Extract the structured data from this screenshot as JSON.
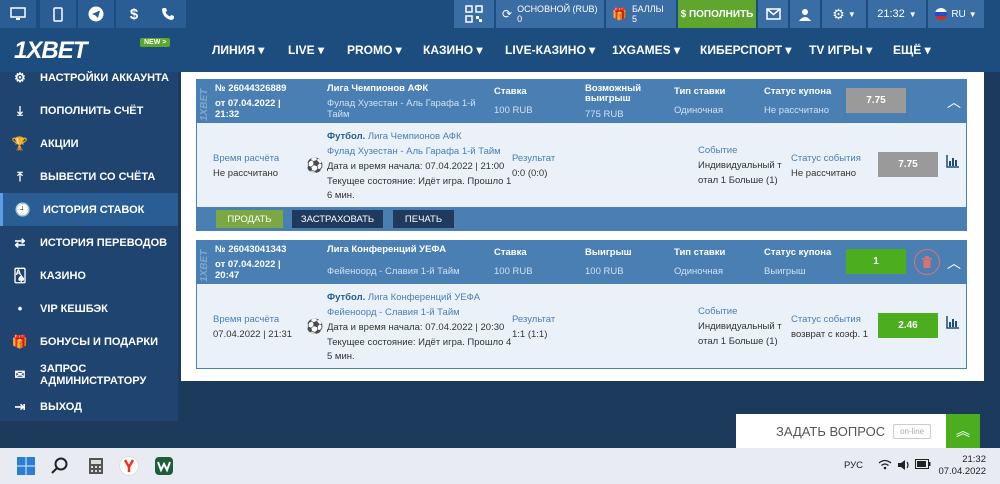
{
  "topbar": {
    "balance_label": "ОСНОВНОЙ (RUB)",
    "balance_value": "0",
    "bonus_label": "БАЛЛЫ",
    "bonus_value": "5",
    "deposit_label": "$ ПОПОЛНИТЬ",
    "time": "21:32",
    "lang": "RU"
  },
  "nav": {
    "logo": "1XBET",
    "new_badge": "NEW >",
    "items": [
      "ЛИНИЯ",
      "LIVE",
      "PROMO",
      "КАЗИНО",
      "LIVE-КАЗИНО",
      "1XGAMES",
      "КИБЕРСПОРТ",
      "TV ИГРЫ",
      "ЕЩЁ"
    ]
  },
  "sidebar": {
    "items": [
      {
        "label": "НАСТРОЙКИ АККАУНТА",
        "icon": "gear-icon"
      },
      {
        "label": "ПОПОЛНИТЬ СЧЁТ",
        "icon": "download-icon"
      },
      {
        "label": "АКЦИИ",
        "icon": "trophy-icon"
      },
      {
        "label": "ВЫВЕСТИ СО СЧЁТА",
        "icon": "upload-icon"
      },
      {
        "label": "ИСТОРИЯ СТАВОК",
        "icon": "clock-icon"
      },
      {
        "label": "ИСТОРИЯ ПЕРЕВОДОВ",
        "icon": "transfer-icon"
      },
      {
        "label": "КАЗИНО",
        "icon": "cards-icon"
      },
      {
        "label": "VIP КЕШБЭК",
        "icon": "dot-icon"
      },
      {
        "label": "БОНУСЫ И ПОДАРКИ",
        "icon": "gift-icon"
      },
      {
        "label": "ЗАПРОС АДМИНИСТРАТОРУ",
        "icon": "mail-icon"
      },
      {
        "label": "ВЫХОД",
        "icon": "logout-icon"
      }
    ]
  },
  "bets": [
    {
      "number": "№ 26044326889",
      "date": "от 07.04.2022 |",
      "time": "21:32",
      "league": "Лига Чемпионов АФК",
      "match_line1": "Фулад Хузестан - Аль Гарафа 1-й",
      "match_line2": "Тайм",
      "stake_label": "Ставка",
      "stake_value": "100 RUB",
      "win_label": "Возможный",
      "win_label2": "выигрыш",
      "win_value": "775 RUB",
      "type_label": "Тип ставки",
      "type_value": "Одиночная",
      "status_label": "Статус купона",
      "status_value": "Не рассчитано",
      "coef": "7.75",
      "detail": {
        "calc_label": "Время расчёта",
        "calc_value": "Не рассчитано",
        "sport": "Футбол.",
        "sport_league": "Лига Чемпионов АФК",
        "match": "Фулад Хузестан - Аль Гарафа 1-й Тайм",
        "start": "Дата и время начала: 07.04.2022 | 21:00",
        "state_line1": "Текущее состояние: Идёт игра. Прошло 1",
        "state_line2": "6 мин.",
        "result_label": "Результат",
        "result_value": "0:0 (0:0)",
        "event_label": "Событие",
        "event_line1": "Индивидуальный т",
        "event_line2": "отал 1 Больше (1)",
        "event_status_label": "Статус события",
        "event_status_value": "Не рассчитано",
        "coef": "7.75"
      },
      "buttons": {
        "sell": "ПРОДАТЬ",
        "insure": "ЗАСТРАХОВАТЬ",
        "print": "ПЕЧАТЬ"
      }
    },
    {
      "number": "№ 26043041343",
      "date": "от 07.04.2022 |",
      "time": "20:47",
      "league": "Лига Конференций УЕФА",
      "match_line1": "Фейеноорд - Славия 1-й Тайм",
      "stake_label": "Ставка",
      "stake_value": "100 RUB",
      "win_label": "Выигрыш",
      "win_value": "100 RUB",
      "type_label": "Тип ставки",
      "type_value": "Одиночная",
      "status_label": "Статус купона",
      "status_value": "Выигрыш",
      "coef": "1",
      "detail": {
        "calc_label": "Время расчёта",
        "calc_value": "07.04.2022 | 21:31",
        "sport": "Футбол.",
        "sport_league": "Лига Конференций УЕФА",
        "match": "Фейеноорд - Славия 1-й Тайм",
        "start": "Дата и время начала: 07.04.2022 | 20:30",
        "state_line1": "Текущее состояние: Идёт игра. Прошло 4",
        "state_line2": "5 мин.",
        "result_label": "Результат",
        "result_value": "1:1 (1:1)",
        "event_label": "Событие",
        "event_line1": "Индивидуальный т",
        "event_line2": "отал 1 Больше (1)",
        "event_status_label": "Статус события",
        "event_status_value": "возврат с коэф. 1",
        "coef": "2.46"
      }
    }
  ],
  "chat": {
    "label": "ЗАДАТЬ ВОПРОС",
    "status": "on-line"
  },
  "taskbar": {
    "lang": "РУС",
    "time": "21:32",
    "date": "07.04.2022"
  },
  "colors": {
    "brand_blue": "#1d4d7e",
    "accent_green": "#4cae1e",
    "coupon_blue": "#4a7fb3"
  }
}
